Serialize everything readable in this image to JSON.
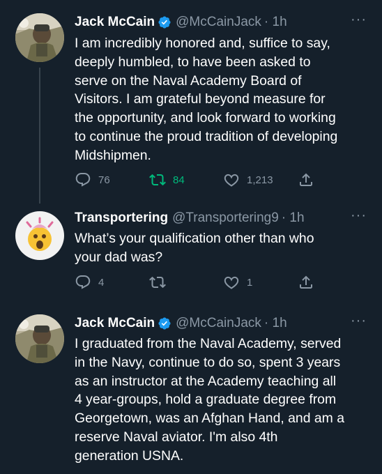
{
  "tweets": [
    {
      "author": "Jack McCain",
      "handle": "@McCainJack",
      "time": "· 1h",
      "text": "I am incredibly honored and, suffice to say,\ndeeply humbled, to have been asked to\nserve on the Naval Academy Board of\nVisitors. I am grateful beyond measure for\nthe opportunity, and look forward to working\nto continue the proud tradition of developing\nMidshipmen.",
      "replies": "76",
      "retweets": "84",
      "likes": "1,213"
    },
    {
      "author": "Transportering",
      "handle": "@Transportering9",
      "time": "· 1h",
      "text": "What’s your qualification other than who\nyour dad was?",
      "replies": "4",
      "retweets": "",
      "likes": "1"
    },
    {
      "author": "Jack McCain",
      "handle": "@McCainJack",
      "time": "· 1h",
      "text": "I graduated from the Naval Academy, served\nin the Navy, continue to do so, spent 3 years\nas an instructor at the Academy teaching all\n4 year-groups, hold a graduate degree from\nGeorgetown, was an Afghan Hand, and am a\nreserve Naval aviator. I'm also 4th\ngeneration USNA."
    }
  ],
  "more_glyph": "···",
  "colors": {
    "background": "#15202b",
    "verified": "#1d9bf0",
    "retweet_active": "#00ba7c",
    "muted": "#8b98a5"
  },
  "icons": [
    "verified-badge-icon",
    "reply-icon",
    "retweet-icon",
    "like-icon",
    "share-icon",
    "more-icon",
    "emoji-avatar"
  ]
}
